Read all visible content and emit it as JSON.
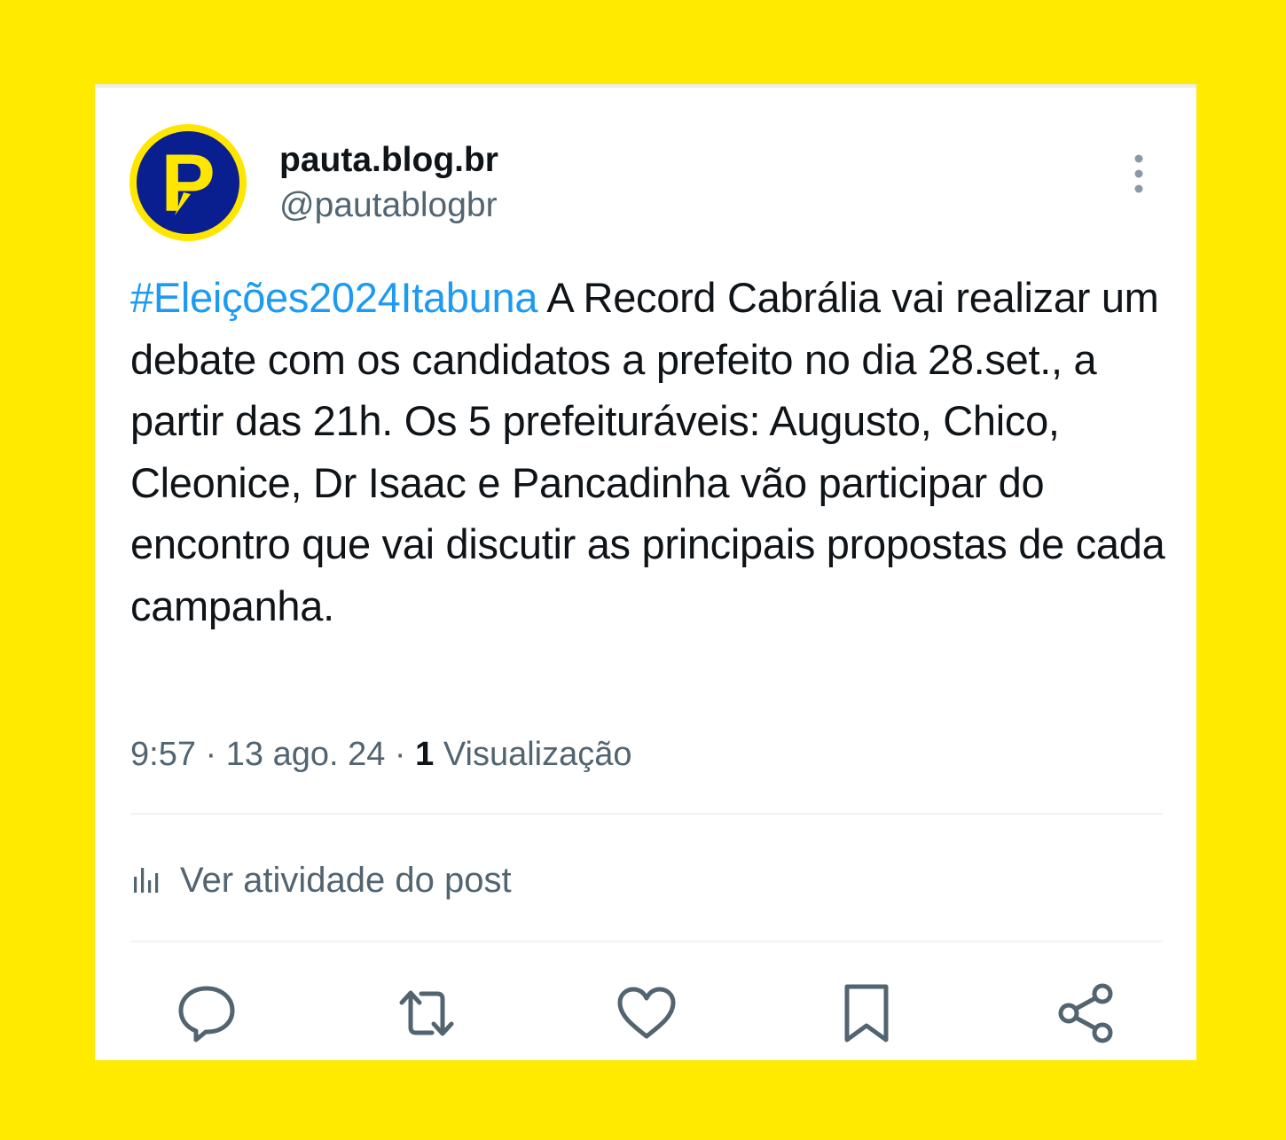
{
  "post": {
    "author_name": "pauta.blog.br",
    "author_handle": "@pautablogbr",
    "avatar_letter": "P",
    "hashtag": "#Eleições2024Itabuna",
    "body": " A Record Cabrália vai realizar um debate com os candidatos a prefeito no dia 28.set., a partir das 21h. Os 5 prefeituráveis: Augusto, Chico, Cleonice, Dr Isaac e Pancadinha vão participar do encontro que vai discutir as principais propostas de cada campanha.",
    "time": "9:57",
    "separator": " · ",
    "date": "13 ago. 24",
    "views_count": "1",
    "views_label": " Visualização",
    "activity_label": "Ver atividade do post"
  },
  "icons": {
    "more": "more-vertical-icon",
    "activity": "bar-chart-icon",
    "reply": "reply-bubble-icon",
    "repost": "repost-icon",
    "like": "heart-icon",
    "bookmark": "bookmark-icon",
    "share": "share-icon"
  },
  "colors": {
    "background": "#ffea00",
    "card": "#ffffff",
    "text_primary": "#0f1419",
    "text_secondary": "#536471",
    "link": "#1d9bf0",
    "avatar_fill": "#0a1f8f",
    "avatar_ring": "#ffe600"
  }
}
